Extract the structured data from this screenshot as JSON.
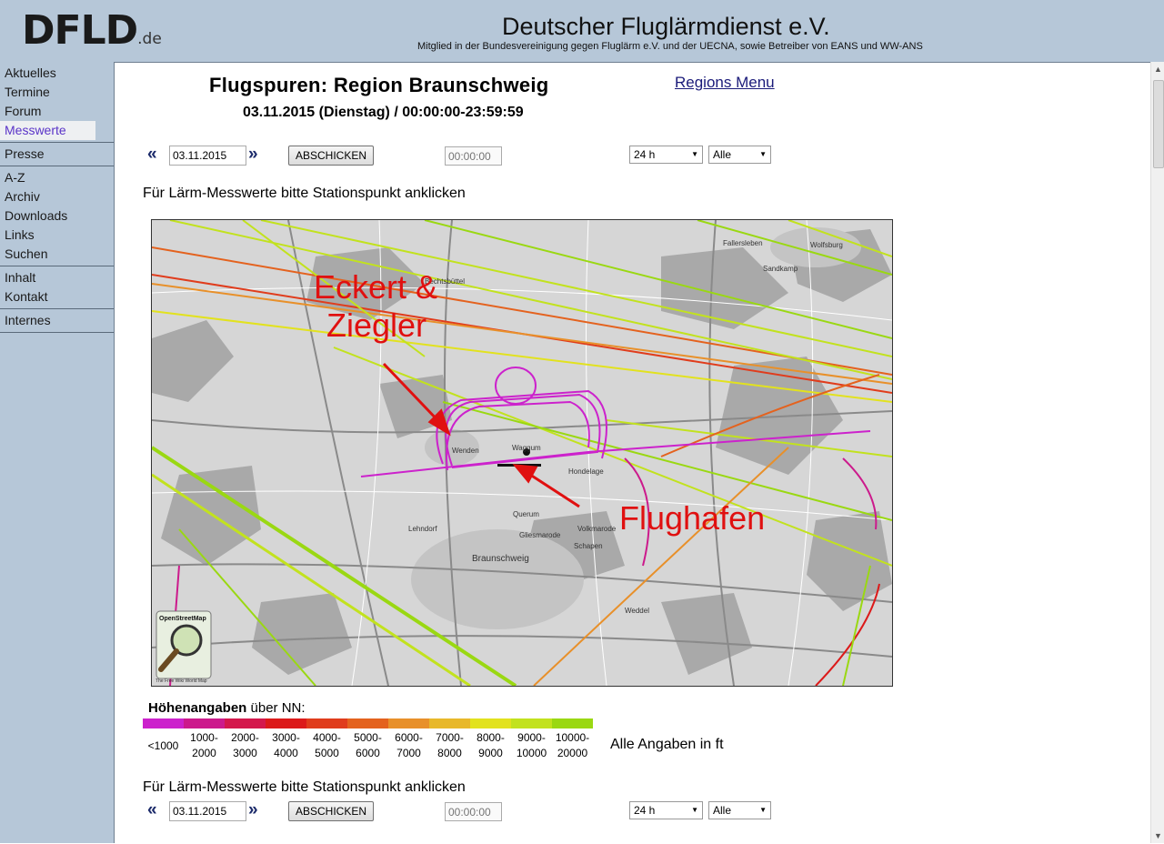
{
  "header": {
    "logo_text": "DFLD",
    "logo_suffix": ".de",
    "title": "Deutscher Fluglärmdienst e.V.",
    "subtitle": "Mitglied in der Bundesvereinigung gegen Fluglärm e.V. und der UECNA, sowie Betreiber von EANS und WW-ANS"
  },
  "sidebar": {
    "groups": [
      [
        "Aktuelles",
        "Termine",
        "Forum",
        "Messwerte"
      ],
      [
        "Presse"
      ],
      [
        "A-Z",
        "Archiv",
        "Downloads",
        "Links",
        "Suchen"
      ],
      [
        "Inhalt",
        "Kontakt"
      ],
      [
        "Internes"
      ]
    ],
    "active": "Messwerte"
  },
  "main": {
    "title": "Flugspuren: Region Braunschweig",
    "date_range": "03.11.2015 (Dienstag) / 00:00:00-23:59:59",
    "regions_link": "Regions Menu",
    "controls": {
      "prev_arrow": "«",
      "next_arrow": "»",
      "date_value": "03.11.2015",
      "submit_label": "ABSCHICKEN",
      "time_placeholder": "00:00:00",
      "span_value": "24 h",
      "filter_value": "Alle"
    },
    "hint": "Für Lärm-Messwerte bitte Stationspunkt anklicken",
    "map": {
      "annotation_1_line1": "Eckert &",
      "annotation_1_line2": "Ziegler",
      "annotation_2": "Flughafen",
      "osm_label": "OpenStreetMap",
      "osm_sublabel": "The Free Wiki World Map",
      "places": [
        "Wolfsburg",
        "Braunschweig",
        "Wenden",
        "Waggum",
        "Querum",
        "Gliesmarode",
        "Bechtsbüttel",
        "Hondelage",
        "Volkmarode",
        "Schapen",
        "Lehndorf",
        "Weddel",
        "Sandkamp",
        "Fallersleben"
      ],
      "annotation_color": "#e01010"
    },
    "legend": {
      "title_bold": "Höhenangaben",
      "title_rest": " über NN:",
      "bins": [
        {
          "line1": "<1000",
          "line2": "",
          "color": "#cc22cc"
        },
        {
          "line1": "1000-",
          "line2": "2000",
          "color": "#cc1a8c"
        },
        {
          "line1": "2000-",
          "line2": "3000",
          "color": "#d4184c"
        },
        {
          "line1": "3000-",
          "line2": "4000",
          "color": "#dc1a1a"
        },
        {
          "line1": "4000-",
          "line2": "5000",
          "color": "#e03c1c"
        },
        {
          "line1": "5000-",
          "line2": "6000",
          "color": "#e4621e"
        },
        {
          "line1": "6000-",
          "line2": "7000",
          "color": "#e8902a"
        },
        {
          "line1": "7000-",
          "line2": "8000",
          "color": "#e8b82a"
        },
        {
          "line1": "8000-",
          "line2": "9000",
          "color": "#e2e21e"
        },
        {
          "line1": "9000-",
          "line2": "10000",
          "color": "#c2e21e"
        },
        {
          "line1": "10000-",
          "line2": "20000",
          "color": "#9ad812"
        }
      ],
      "note": "Alle Angaben in ft"
    }
  },
  "scrollbar": {
    "up": "▲",
    "down": "▼"
  }
}
